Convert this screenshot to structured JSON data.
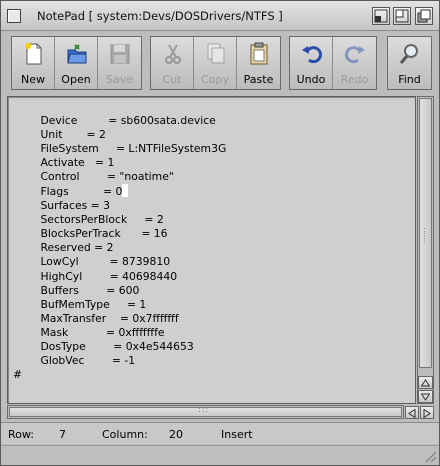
{
  "window": {
    "title": "NotePad [ system:Devs/DOSDrivers/NTFS ]"
  },
  "toolbar": {
    "buttons": [
      {
        "label": "New",
        "icon": "new-document-icon",
        "enabled": true
      },
      {
        "label": "Open",
        "icon": "open-folder-icon",
        "enabled": true
      },
      {
        "label": "Save",
        "icon": "floppy-disk-icon",
        "enabled": false
      },
      {
        "label": "Cut",
        "icon": "scissors-icon",
        "enabled": false
      },
      {
        "label": "Copy",
        "icon": "copy-icon",
        "enabled": false
      },
      {
        "label": "Paste",
        "icon": "clipboard-icon",
        "enabled": true
      },
      {
        "label": "Undo",
        "icon": "undo-icon",
        "enabled": true
      },
      {
        "label": "Redo",
        "icon": "redo-icon",
        "enabled": false
      },
      {
        "label": "Find",
        "icon": "magnifier-icon",
        "enabled": true
      }
    ]
  },
  "editor": {
    "lines": [
      "Device         = sb600sata.device",
      "Unit       = 2",
      "FileSystem     = L:NTFileSystem3G",
      "Activate   = 1",
      "Control        = \"noatime\"",
      "Flags          = 0",
      "Surfaces = 3",
      "SectorsPerBlock     = 2",
      "BlocksPerTrack      = 16",
      "Reserved = 2",
      "LowCyl         = 8739810",
      "HighCyl        = 40698440",
      "Buffers        = 600",
      "BufMemType     = 1",
      "MaxTransfer    = 0x7fffffff",
      "Mask           = 0xfffffffe",
      "DosType        = 0x4e544653",
      "GlobVec        = -1",
      "#"
    ],
    "cursor_line": 6
  },
  "status": {
    "row_label": "Row:",
    "row_value": "7",
    "column_label": "Column:",
    "column_value": "20",
    "mode": "Insert"
  },
  "colors": {
    "window_bg": "#bdbdbd",
    "editor_bg": "#cfcfcf",
    "cursor": "#ffffff"
  }
}
